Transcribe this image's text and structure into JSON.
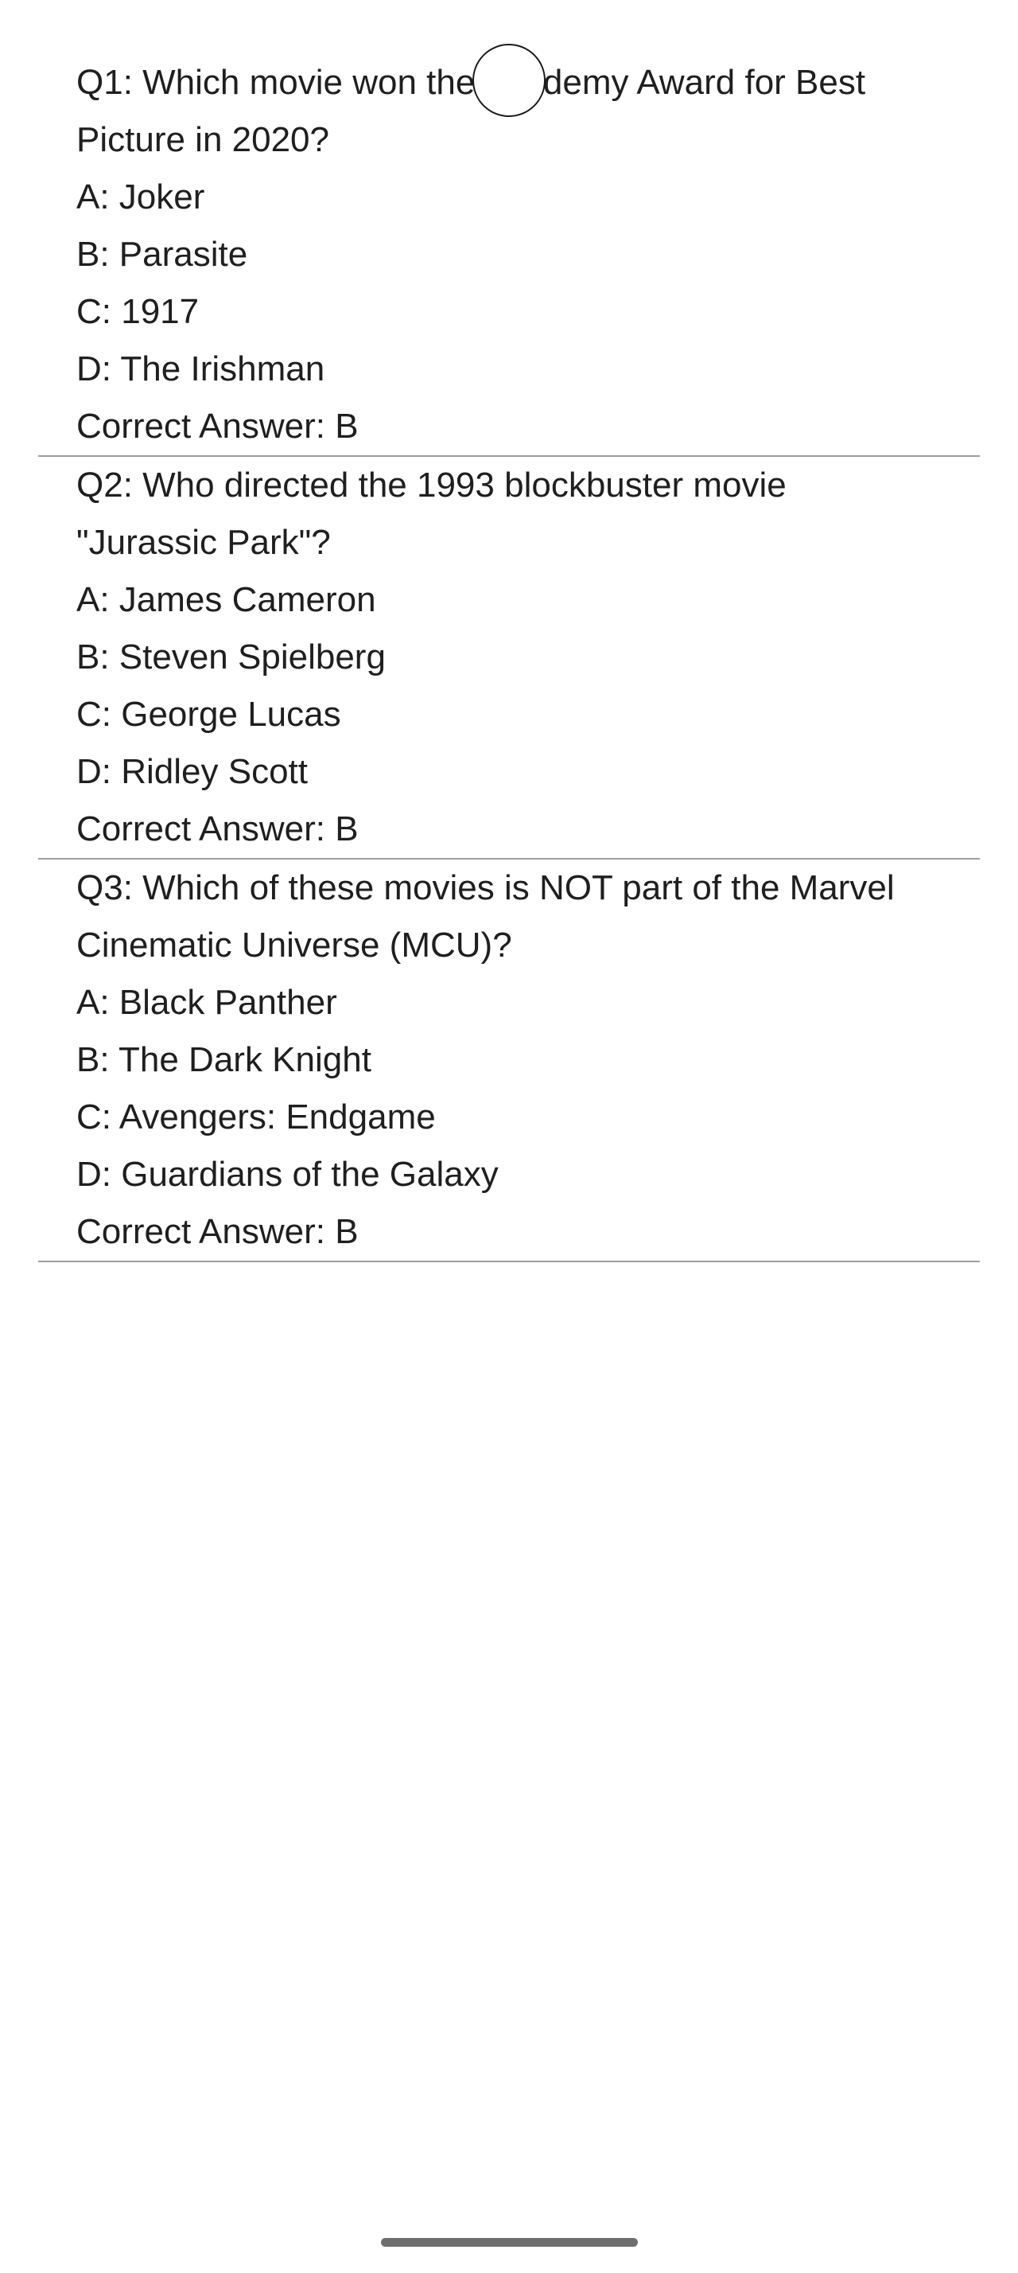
{
  "questions": [
    {
      "question": "Q1: Which movie won the Academy Award for Best Picture in 2020?",
      "option_a": "A: Joker",
      "option_b": "B: Parasite",
      "option_c": "C: 1917",
      "option_d": "D: The Irishman",
      "correct": "Correct Answer: B"
    },
    {
      "question": "Q2: Who directed the 1993 blockbuster movie \"Jurassic Park\"?",
      "option_a": "A: James Cameron",
      "option_b": "B: Steven Spielberg",
      "option_c": "C: George Lucas",
      "option_d": "D: Ridley Scott",
      "correct": "Correct Answer: B"
    },
    {
      "question": "Q3: Which of these movies is NOT part of the Marvel Cinematic Universe (MCU)?",
      "option_a": "A: Black Panther",
      "option_b": "B: The Dark Knight",
      "option_c": "C: Avengers: Endgame",
      "option_d": "D: Guardians of the Galaxy",
      "correct": "Correct Answer: B"
    }
  ]
}
